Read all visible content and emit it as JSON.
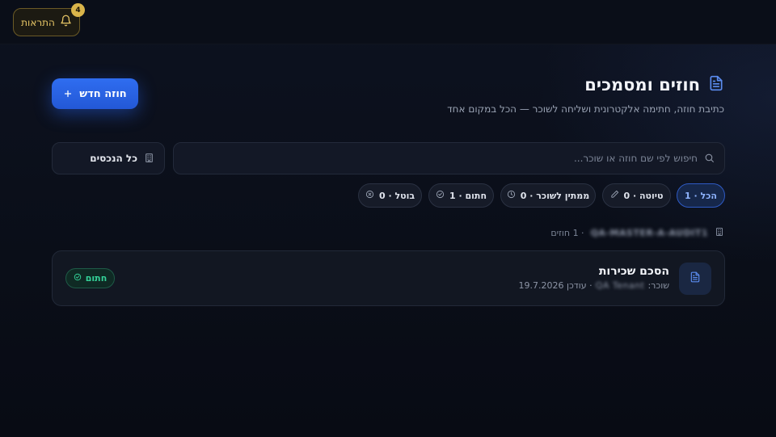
{
  "topbar": {
    "notifications_label": "התראות",
    "notifications_count": "4"
  },
  "header": {
    "title": "חוזים ומסמכים",
    "subtitle": "כתיבת חוזה, חתימה אלקטרונית ושליחה לשוכר — הכל במקום אחד",
    "new_contract_label": "חוזה חדש"
  },
  "filters": {
    "search_placeholder": "חיפוש לפי שם חוזה או שוכר...",
    "property_select_label": "כל הנכסים",
    "chips": [
      {
        "label": "הכל · 1",
        "active": true,
        "icon": ""
      },
      {
        "label": "טיוטה · 0",
        "active": false,
        "icon": "pencil-icon"
      },
      {
        "label": "ממתין לשוכר · 0",
        "active": false,
        "icon": "clock-icon"
      },
      {
        "label": "חתום · 1",
        "active": false,
        "icon": "check-circle-icon"
      },
      {
        "label": "בוטל · 0",
        "active": false,
        "icon": "x-circle-icon"
      }
    ]
  },
  "group": {
    "property_name": "QA-MASTER-A-AUDIT1",
    "count_label": "· 1 חוזים"
  },
  "contracts": [
    {
      "title": "הסכם שכירות",
      "tenant_prefix": "שוכר:",
      "tenant_name": "QA Tenant",
      "updated_label": "· עודכן 19.7.2026",
      "status": "חתום"
    }
  ],
  "colors": {
    "accent": "#2f6df0",
    "notification_gold": "#d9b44a",
    "signed_green": "#34d399",
    "background": "#0b0f1a"
  }
}
